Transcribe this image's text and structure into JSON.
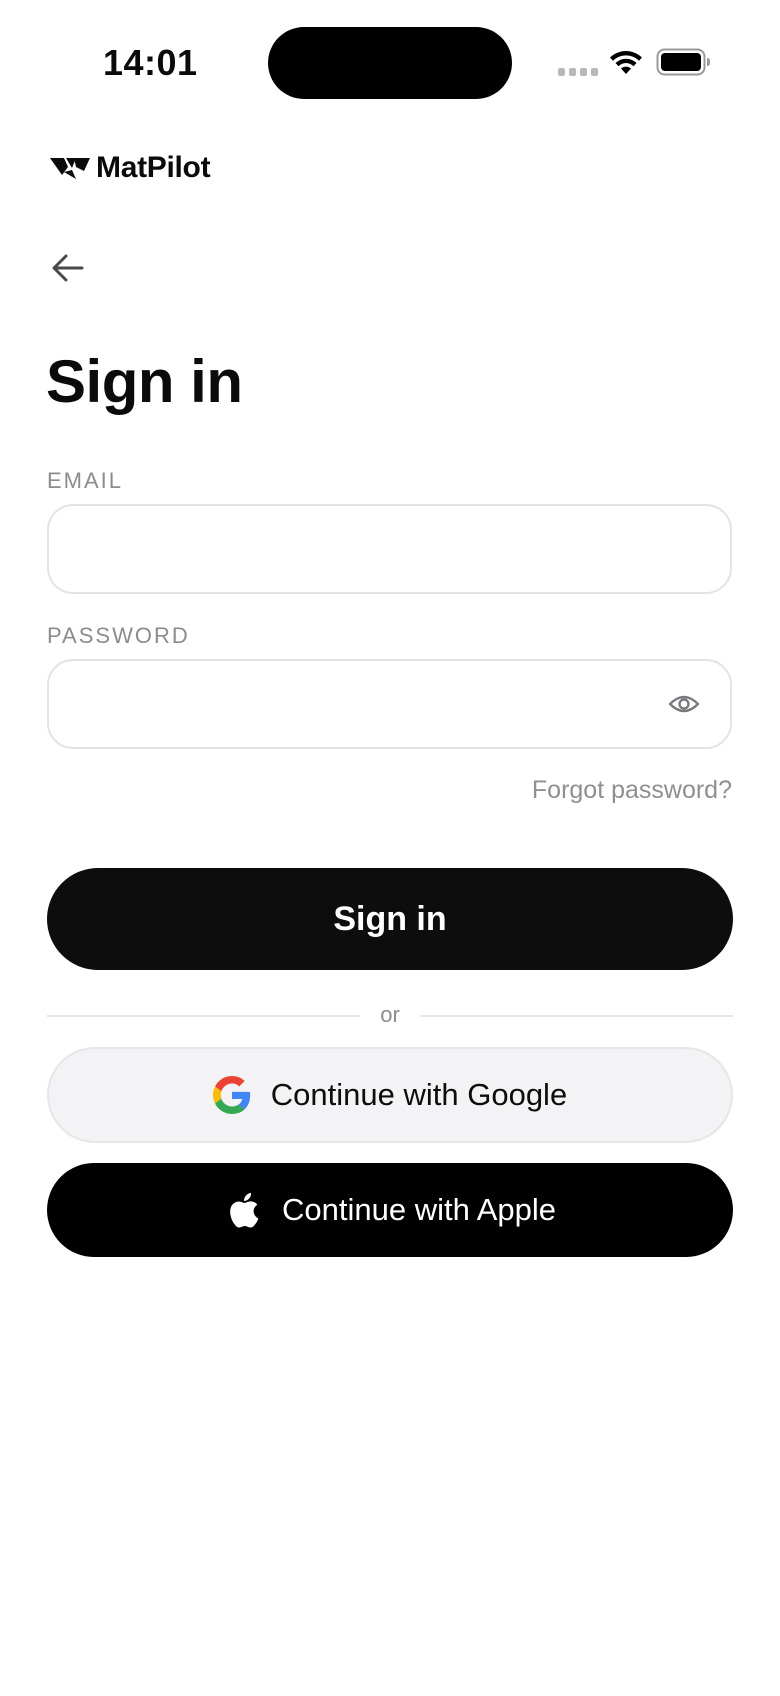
{
  "status_bar": {
    "time": "14:01",
    "icons": [
      "signal-icon",
      "wifi-icon",
      "battery-icon"
    ]
  },
  "brand": {
    "name": "MatPilot",
    "logo_icon": "matpilot-logo-icon"
  },
  "navigation": {
    "back_icon": "arrow-left-icon"
  },
  "page": {
    "title": "Sign in"
  },
  "form": {
    "email": {
      "label": "EMAIL",
      "value": "",
      "placeholder": ""
    },
    "password": {
      "label": "PASSWORD",
      "value": "",
      "placeholder": "",
      "toggle_icon": "eye-icon"
    },
    "forgot_password": "Forgot password?",
    "submit_label": "Sign in"
  },
  "divider": {
    "text": "or"
  },
  "social": {
    "google_label": "Continue with Google",
    "google_icon": "google-icon",
    "apple_label": "Continue with Apple",
    "apple_icon": "apple-icon"
  },
  "colors": {
    "primary_button": "#0d0d0d",
    "apple_button": "#000000",
    "google_button": "#f3f3f5",
    "label_gray": "#8c8c8f",
    "input_border": "#e3e3e6"
  }
}
